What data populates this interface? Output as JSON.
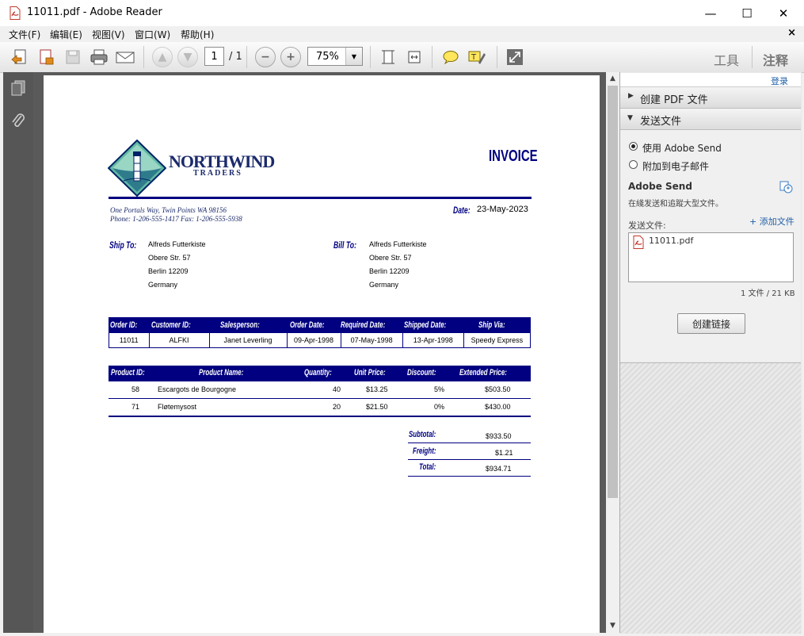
{
  "window": {
    "title": "11011.pdf - Adobe Reader",
    "minimize": "—",
    "maximize": "☐",
    "close": "✕"
  },
  "menu": {
    "items": [
      "文件(F)",
      "编辑(E)",
      "视图(V)",
      "窗口(W)",
      "帮助(H)"
    ],
    "close": "×"
  },
  "toolbar": {
    "page_current": "1",
    "page_total": "/ 1",
    "zoom": "75%",
    "tools_label": "工具",
    "comment_label": "注释"
  },
  "right_panel": {
    "login": "登录",
    "create_pdf": "创建 PDF 文件",
    "send_file": "发送文件",
    "option_adobe_send": "使用 Adobe Send",
    "option_email": "附加到电子邮件",
    "adobe_send_title": "Adobe Send",
    "adobe_send_desc": "在綫发送和追蹤大型文件。",
    "send_files_label": "发送文件:",
    "add_file": "+ 添加文件",
    "file_name": "11011.pdf",
    "file_info": "1 文件 / 21 KB",
    "create_link": "创建链接"
  },
  "invoice": {
    "company_name": "NORTHWIND",
    "company_sub": "TRADERS",
    "heading": "INVOICE",
    "address_line1": "One Portals Way, Twin Points WA  98156",
    "address_line2": "Phone: 1-206-555-1417   Fax: 1-206-555-5938",
    "date_label": "Date:",
    "date_value": "23-May-2023",
    "ship_to_label": "Ship To:",
    "ship_to": [
      "Alfreds Futterkiste",
      "Obere Str. 57",
      "Berlin  12209",
      "Germany"
    ],
    "bill_to_label": "Bill To:",
    "bill_to": [
      "Alfreds Futterkiste",
      "Obere Str. 57",
      "Berlin  12209",
      "Germany"
    ],
    "order_headers": [
      "Order ID:",
      "Customer ID:",
      "Salesperson:",
      "Order Date:",
      "Required Date:",
      "Shipped Date:",
      "Ship Via:"
    ],
    "order_values": [
      "11011",
      "ALFKI",
      "Janet Leverling",
      "09-Apr-1998",
      "07-May-1998",
      "13-Apr-1998",
      "Speedy Express"
    ],
    "item_headers": [
      "Product ID:",
      "Product Name:",
      "Quantity:",
      "Unit Price:",
      "Discount:",
      "Extended Price:"
    ],
    "items": [
      {
        "id": "58",
        "name": "Escargots de Bourgogne",
        "qty": "40",
        "price": "$13.25",
        "discount": "5%",
        "extended": "$503.50"
      },
      {
        "id": "71",
        "name": "Fløtemysost",
        "qty": "20",
        "price": "$21.50",
        "discount": "0%",
        "extended": "$430.00"
      }
    ],
    "subtotal_label": "Subtotal:",
    "subtotal": "$933.50",
    "freight_label": "Freight:",
    "freight": "$1.21",
    "total_label": "Total:",
    "total": "$934.71"
  }
}
